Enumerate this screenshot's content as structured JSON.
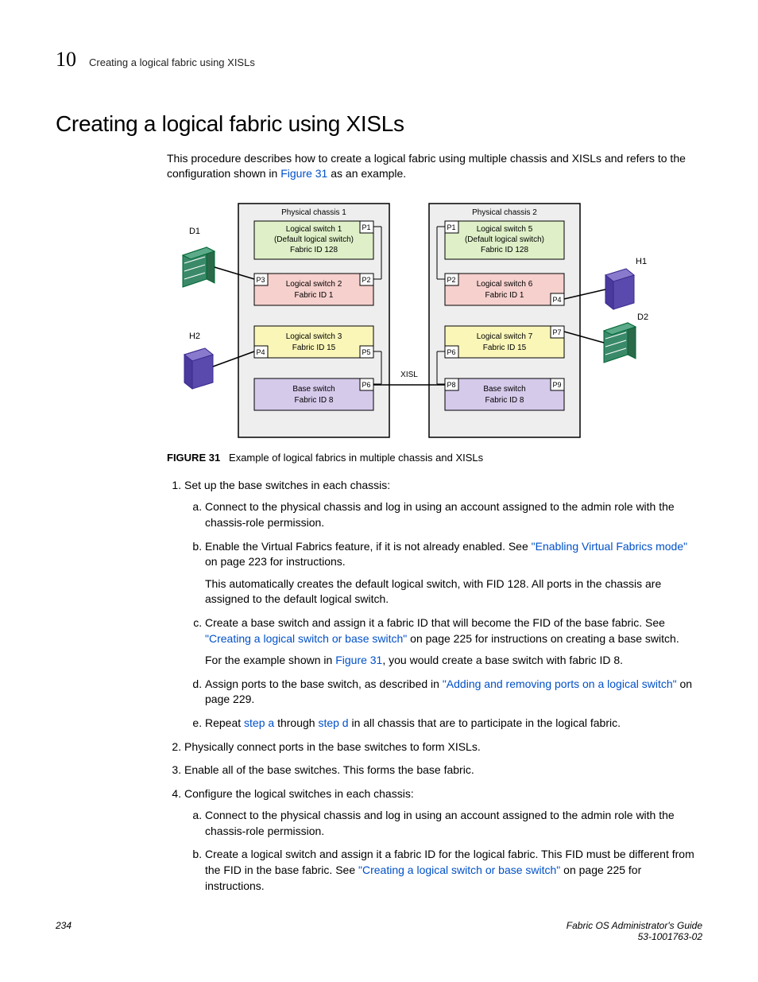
{
  "header": {
    "chapter": "10",
    "section_title": "Creating a logical fabric using XISLs"
  },
  "title": "Creating a logical fabric using XISLs",
  "intro": {
    "t1": "This procedure describes how to create a logical fabric using multiple chassis and XISLs and refers to the configuration shown in ",
    "link": "Figure 31",
    "t2": " as an example."
  },
  "diagram": {
    "chassis1": "Physical chassis 1",
    "chassis2": "Physical chassis 2",
    "ls1a": "Logical switch 1",
    "ls1b": "(Default logical switch)",
    "ls1c": "Fabric ID 128",
    "ls2a": "Logical switch 2",
    "ls2b": "Fabric ID 1",
    "ls3a": "Logical switch 3",
    "ls3b": "Fabric ID 15",
    "bs1a": "Base switch",
    "bs1b": "Fabric ID 8",
    "ls5a": "Logical switch 5",
    "ls5b": "(Default logical switch)",
    "ls5c": "Fabric ID 128",
    "ls6a": "Logical switch 6",
    "ls6b": "Fabric ID 1",
    "ls7a": "Logical switch 7",
    "ls7b": "Fabric ID 15",
    "bs2a": "Base switch",
    "bs2b": "Fabric ID 8",
    "d1": "D1",
    "d2": "D2",
    "h1": "H1",
    "h2": "H2",
    "xisl": "XISL",
    "p1": "P1",
    "p2": "P2",
    "p3": "P3",
    "p4": "P4",
    "p5": "P5",
    "p6": "P6",
    "p7": "P7",
    "p8": "P8",
    "p9": "P9"
  },
  "figure_caption": {
    "label": "FIGURE 31",
    "text": "Example of logical fabrics in multiple chassis and XISLs"
  },
  "steps": {
    "s1": "Set up the base switches in each chassis:",
    "s1a": "Connect to the physical chassis and log in using an account assigned to the admin role with the chassis-role permission.",
    "s1b_t1": "Enable the Virtual Fabrics feature, if it is not already enabled. See ",
    "s1b_link": "\"Enabling Virtual Fabrics mode\"",
    "s1b_t2": " on page 223 for instructions.",
    "s1b_para": "This automatically creates the default logical switch, with FID 128. All ports in the chassis are assigned to the default logical switch.",
    "s1c_t1": "Create a base switch and assign it a fabric ID that will become the FID of the base fabric. See ",
    "s1c_link": "\"Creating a logical switch or base switch\"",
    "s1c_t2": " on page 225 for instructions on creating a base switch.",
    "s1c_para_t1": "For the example shown in ",
    "s1c_para_link": "Figure 31",
    "s1c_para_t2": ", you would create a base switch with fabric ID 8.",
    "s1d_t1": "Assign ports to the base switch, as described in ",
    "s1d_link": "\"Adding and removing ports on a logical switch\"",
    "s1d_t2": " on page 229.",
    "s1e_t1": "Repeat ",
    "s1e_l1": "step a",
    "s1e_t2": " through ",
    "s1e_l2": "step d",
    "s1e_t3": " in all chassis that are to participate in the logical fabric.",
    "s2": "Physically connect ports in the base switches to form XISLs.",
    "s3": "Enable all of the base switches. This forms the base fabric.",
    "s4": "Configure the logical switches in each chassis:",
    "s4a": "Connect to the physical chassis and log in using an account assigned to the admin role with the chassis-role permission.",
    "s4b_t1": "Create a logical switch and assign it a fabric ID for the logical fabric. This FID must be different from the FID in the base fabric. See ",
    "s4b_link": "\"Creating a logical switch or base switch\"",
    "s4b_t2": " on page 225 for instructions."
  },
  "footer": {
    "page": "234",
    "title": "Fabric OS Administrator's Guide",
    "docnum": "53-1001763-02"
  }
}
